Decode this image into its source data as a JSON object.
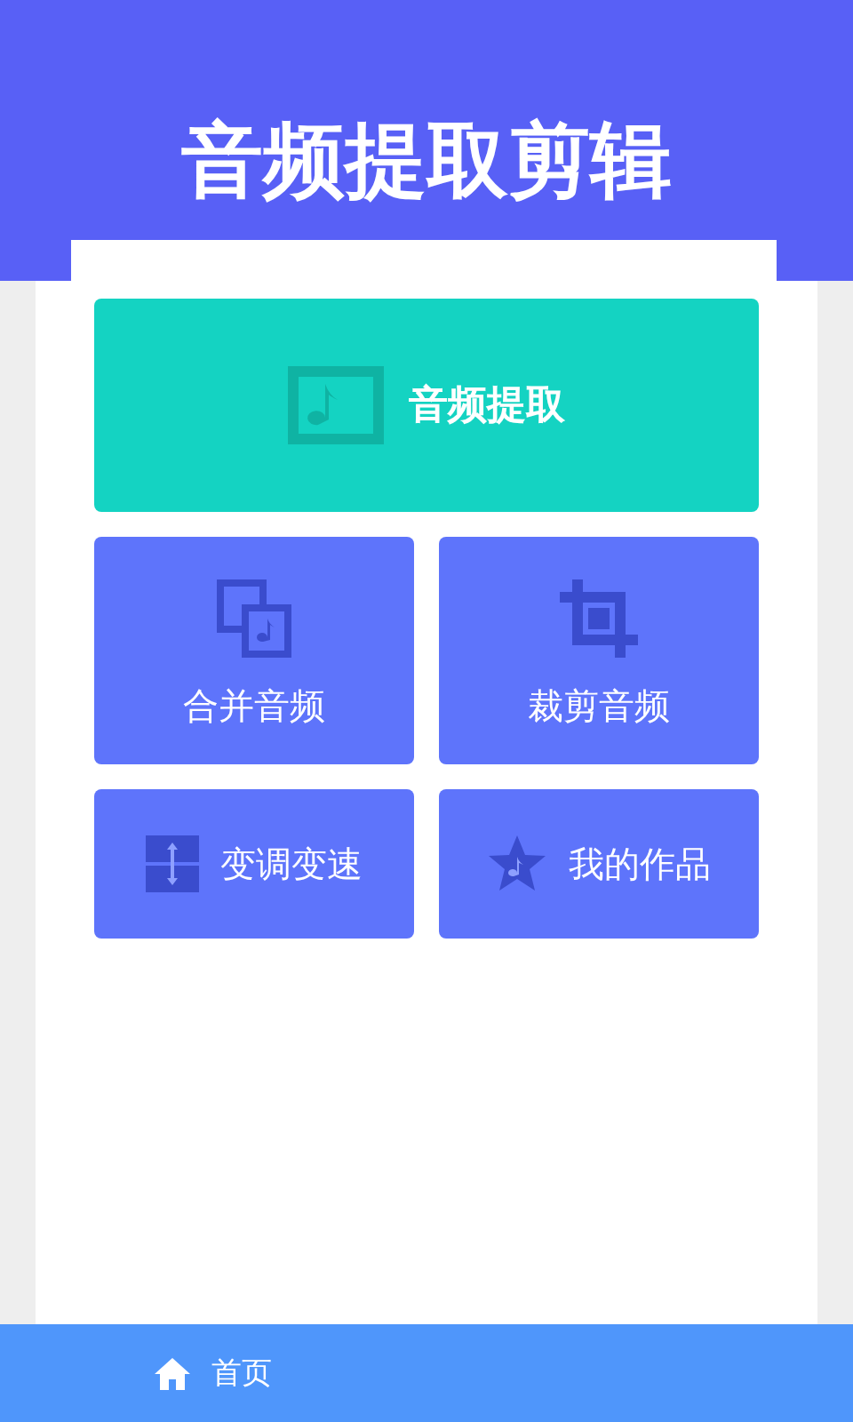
{
  "header": {
    "title": "音频提取剪辑"
  },
  "main_action": {
    "label": "音频提取"
  },
  "actions": [
    {
      "label": "合并音频"
    },
    {
      "label": "裁剪音频"
    },
    {
      "label": "变调变速"
    },
    {
      "label": "我的作品"
    }
  ],
  "bottom_nav": [
    {
      "label": "首页",
      "selected": true
    }
  ]
}
